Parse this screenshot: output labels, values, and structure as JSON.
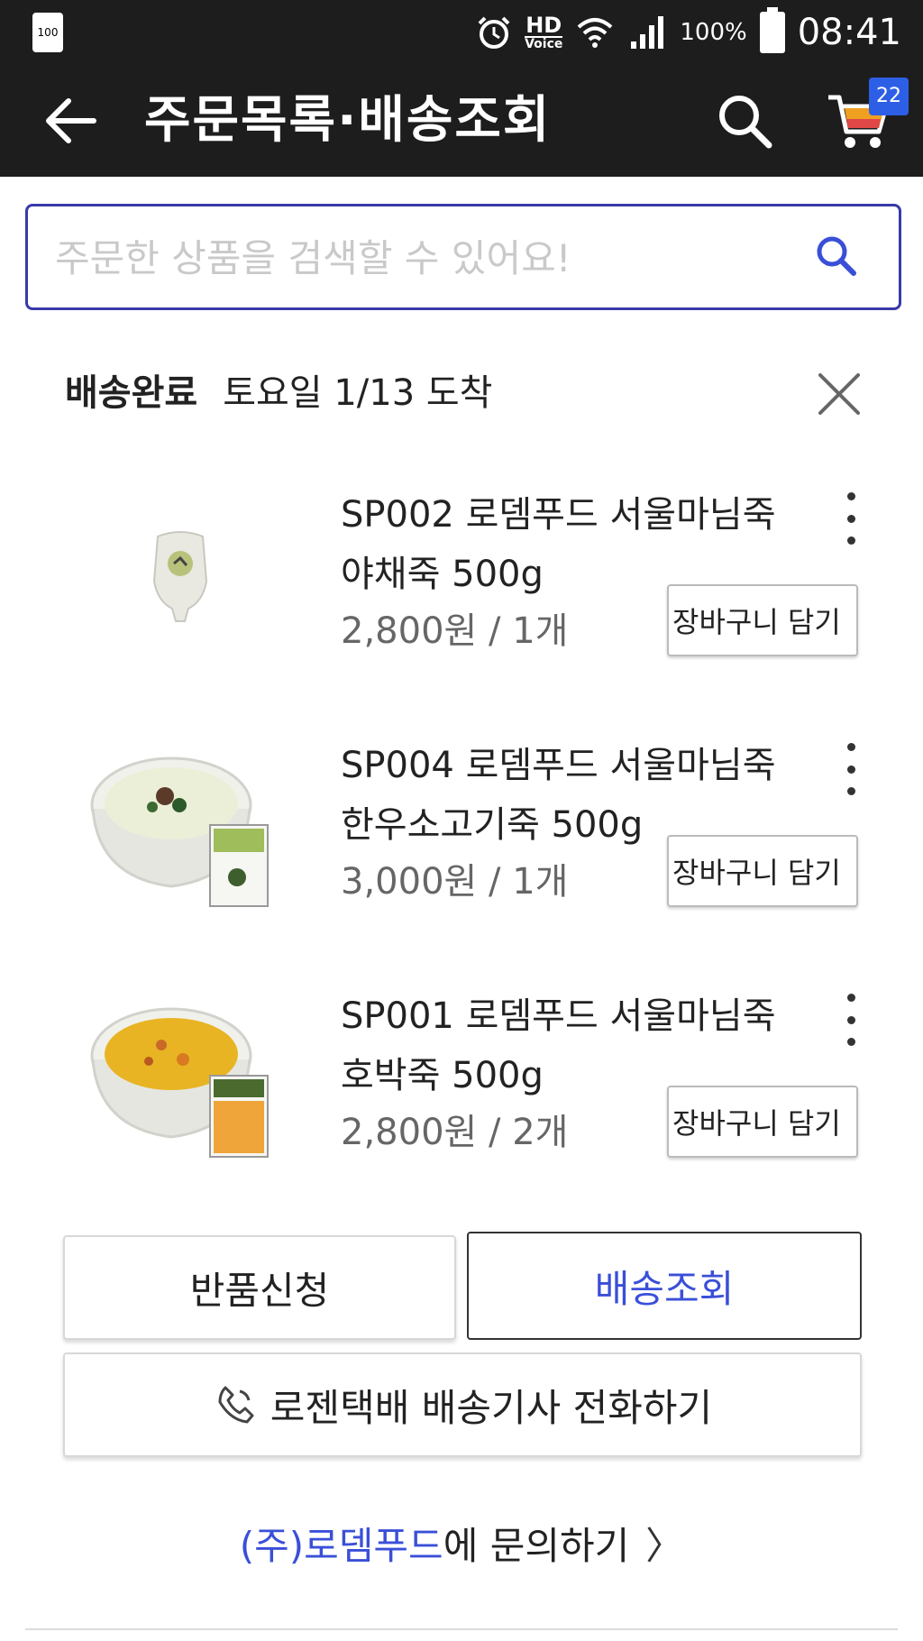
{
  "status_bar": {
    "battery_small_label": "100",
    "hd_label": "HD",
    "voice_label": "Voice",
    "battery_percent": "100%",
    "time": "08:41"
  },
  "app_bar": {
    "title": "주문목록·배송조회",
    "cart_count": "22"
  },
  "search": {
    "placeholder": "주문한 상품을 검색할 수 있어요!",
    "value": ""
  },
  "order": {
    "status": "배송완료",
    "arrival": "토요일 1/13 도착"
  },
  "items": [
    {
      "name": "SP002 로뎀푸드 서울마님죽 야채죽 500g",
      "price": "2,800원 / 1개",
      "cart_label": "장바구니 담기"
    },
    {
      "name": "SP004 로뎀푸드 서울마님죽 한우소고기죽 500g",
      "price": "3,000원 / 1개",
      "cart_label": "장바구니 담기"
    },
    {
      "name": "SP001 로뎀푸드 서울마님죽 호박죽 500g",
      "price": "2,800원 / 2개",
      "cart_label": "장바구니 담기"
    }
  ],
  "actions": {
    "return_label": "반품신청",
    "track_label": "배송조회",
    "call_label": "로젠택배 배송기사 전화하기"
  },
  "inquiry": {
    "seller": "(주)로뎀푸드",
    "text": "에 문의하기",
    "chevron": "〉"
  },
  "colors": {
    "header_bg": "#1d1d1d",
    "accent": "#3a4fd8",
    "badge": "#2d5fe6"
  }
}
